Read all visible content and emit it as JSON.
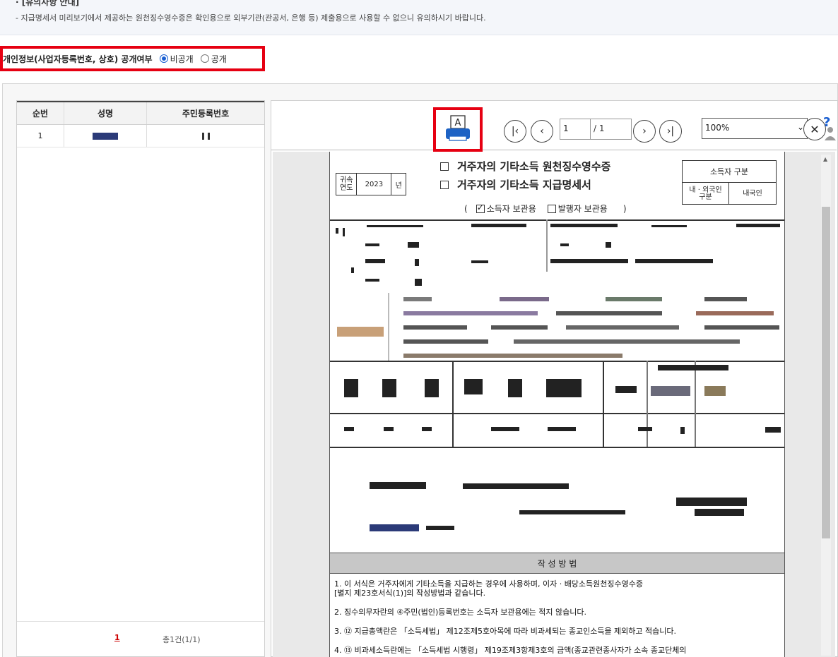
{
  "notice": {
    "title": "· [유의사항 안내]",
    "line": "-  지급명세서 미리보기에서 제공하는 원천징수영수증은 확인용으로 외부기관(관공서, 은행 등) 제출용으로 사용할 수 없으니 유의하시기 바랍니다."
  },
  "privacy": {
    "label": "개인정보(사업자등록번호, 상호) 공개여부",
    "options": [
      "비공개",
      "공개"
    ],
    "selected": "비공개"
  },
  "list": {
    "headers": [
      "순번",
      "성명",
      "주민등록번호"
    ],
    "rows": [
      {
        "no": "1"
      }
    ],
    "page": "1",
    "total": "총1건(1/1)"
  },
  "viewer": {
    "page_current": "1",
    "page_total": "/ 1",
    "zoom": "100%",
    "icons": {
      "first": "first-page-icon",
      "prev": "prev-page-icon",
      "next": "next-page-icon",
      "last": "last-page-icon",
      "close": "close-icon",
      "help": "help-icon",
      "print": "print-icon"
    }
  },
  "document": {
    "year_label": "귀속\n연도",
    "year": "2023",
    "year_unit": "년",
    "title1": "거주자의 기타소득 원천징수영수증",
    "title2": "거주자의 기타소득 지급명세서",
    "holder_open": "(",
    "holder1": "소득자 보관용",
    "holder2": "발행자 보관용",
    "holder_close": ")",
    "taxpayer_label": "소득자 구분",
    "resident_label": "내 · 외국인\n구분",
    "resident_value": "내국인",
    "guide_title": "작 성 방 법",
    "guide": [
      "1. 이 서식은 거주자에게 기타소득을 지급하는 경우에 사용하며, 이자 · 배당소득원천징수영수증",
      "    [별지 제23호서식(1)]의 작성방법과 같습니다.",
      "2. 징수의무자란의 ④주민(법인)등록번호는 소득자 보관용에는 적지 않습니다.",
      "3. ⑫ 지급총액란은 「소득세법」 제12조제5호아목에 따라 비과세되는 종교인소득을 제외하고 적습니다.",
      "4. ⑬ 비과세소득란에는 「소득세법 시행령」 제19조제3항제3호의 금액(종교관련종사자가 소속 종교단체의"
    ]
  }
}
